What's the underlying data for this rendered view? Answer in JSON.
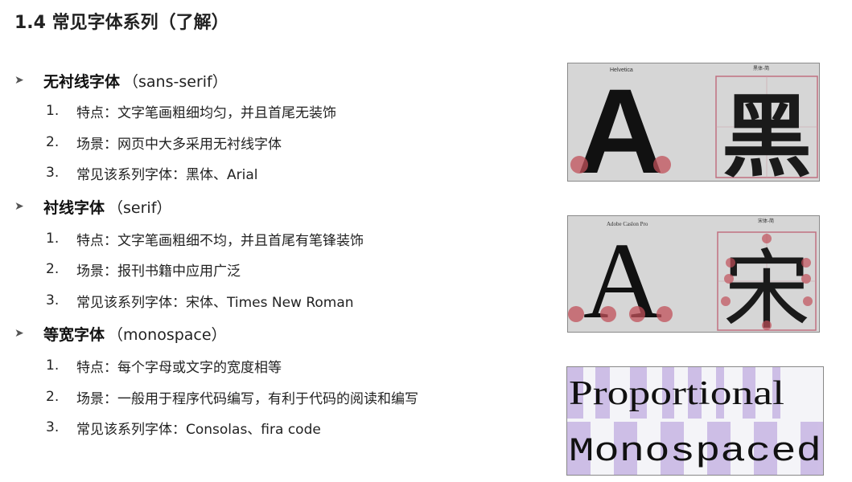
{
  "title": "1.4 常见字体系列（了解）",
  "sections": [
    {
      "title": "无衬线字体",
      "note": "（sans-serif）",
      "items": [
        {
          "num": "1.",
          "text": "特点：文字笔画粗细均匀，并且首尾无装饰"
        },
        {
          "num": "2.",
          "text": "场景：网页中大多采用无衬线字体"
        },
        {
          "num": "3.",
          "text": "常见该系列字体：黑体、Arial"
        }
      ]
    },
    {
      "title": "衬线字体",
      "note": "（serif）",
      "items": [
        {
          "num": "1.",
          "text": "特点：文字笔画粗细不均，并且首尾有笔锋装饰"
        },
        {
          "num": "2.",
          "text": "场景：报刊书籍中应用广泛"
        },
        {
          "num": "3.",
          "text": "常见该系列字体：宋体、Times New Roman"
        }
      ]
    },
    {
      "title": "等宽字体",
      "note": "（monospace）",
      "items": [
        {
          "num": "1.",
          "text": "特点：每个字母或文字的宽度相等"
        },
        {
          "num": "2.",
          "text": "场景：一般用于程序代码编写，有利于代码的阅读和编写"
        },
        {
          "num": "3.",
          "text": "常见该系列字体：Consolas、fira code"
        }
      ]
    }
  ],
  "samples": {
    "sans": {
      "caption_left": "Helvetica",
      "caption_right": "黑体-简",
      "letter": "A",
      "glyph": "黑"
    },
    "serif": {
      "caption_left": "Adobe Caslon Pro",
      "caption_right": "宋体-简",
      "letter": "A",
      "glyph": "宋"
    },
    "mono": {
      "proportional": "Proportional",
      "monospaced": "Monospaced"
    }
  },
  "colors": {
    "marker": "#c0505a",
    "mono_highlight": "#c7b5e3"
  }
}
